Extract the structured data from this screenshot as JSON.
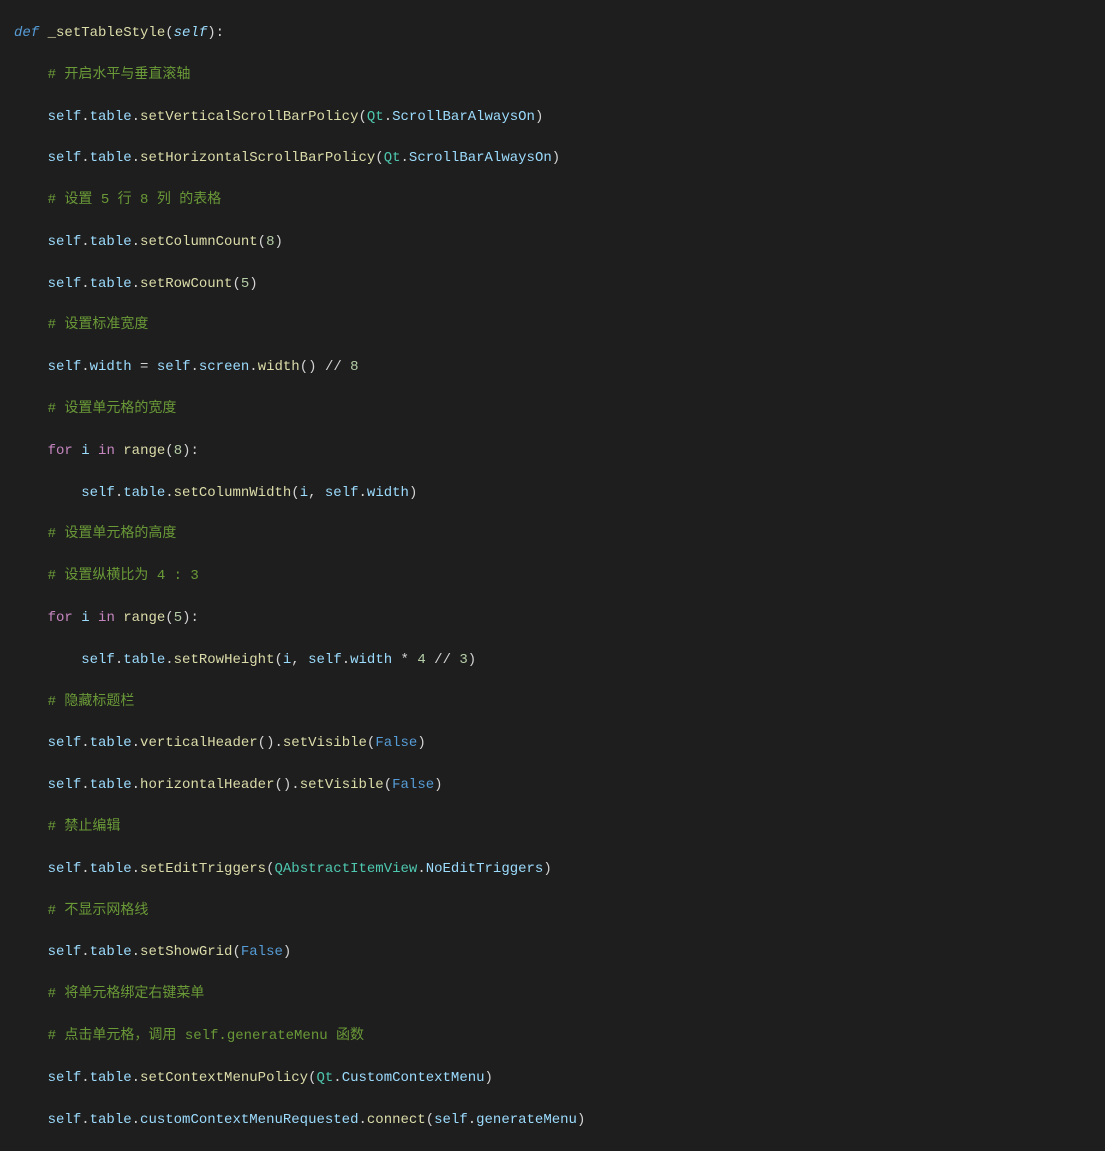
{
  "code": {
    "l1_def": "def",
    "l1_fn": "_setTableStyle",
    "l1_self": "self",
    "l2_cmt": "# 开启水平与垂直滚轴",
    "l3_self": "self",
    "l3_table": "table",
    "l3_method": "setVerticalScrollBarPolicy",
    "l3_cls": "Qt",
    "l3_const": "ScrollBarAlwaysOn",
    "l4_self": "self",
    "l4_table": "table",
    "l4_method": "setHorizontalScrollBarPolicy",
    "l4_cls": "Qt",
    "l4_const": "ScrollBarAlwaysOn",
    "l5_cmt": "# 设置 5 行 8 列 的表格",
    "l6_self": "self",
    "l6_table": "table",
    "l6_method": "setColumnCount",
    "l6_num": "8",
    "l7_self": "self",
    "l7_table": "table",
    "l7_method": "setRowCount",
    "l7_num": "5",
    "l8_cmt": "# 设置标准宽度",
    "l9_self1": "self",
    "l9_width": "width",
    "l9_eq": "=",
    "l9_self2": "self",
    "l9_screen": "screen",
    "l9_method": "width",
    "l9_op": "//",
    "l9_num": "8",
    "l10_cmt": "# 设置单元格的宽度",
    "l11_for": "for",
    "l11_i": "i",
    "l11_in": "in",
    "l11_range": "range",
    "l11_num": "8",
    "l12_self": "self",
    "l12_table": "table",
    "l12_method": "setColumnWidth",
    "l12_i": "i",
    "l12_self2": "self",
    "l12_width": "width",
    "l13_cmt": "# 设置单元格的高度",
    "l14_cmt": "# 设置纵横比为 4 : 3",
    "l15_for": "for",
    "l15_i": "i",
    "l15_in": "in",
    "l15_range": "range",
    "l15_num": "5",
    "l16_self": "self",
    "l16_table": "table",
    "l16_method": "setRowHeight",
    "l16_i": "i",
    "l16_self2": "self",
    "l16_width": "width",
    "l16_mul": "*",
    "l16_n4": "4",
    "l16_div": "//",
    "l16_n3": "3",
    "l17_cmt": "# 隐藏标题栏",
    "l18_self": "self",
    "l18_table": "table",
    "l18_method1": "verticalHeader",
    "l18_method2": "setVisible",
    "l18_false": "False",
    "l19_self": "self",
    "l19_table": "table",
    "l19_method1": "horizontalHeader",
    "l19_method2": "setVisible",
    "l19_false": "False",
    "l20_cmt": "# 禁止编辑",
    "l21_self": "self",
    "l21_table": "table",
    "l21_method": "setEditTriggers",
    "l21_cls": "QAbstractItemView",
    "l21_const": "NoEditTriggers",
    "l22_cmt": "# 不显示网格线",
    "l23_self": "self",
    "l23_table": "table",
    "l23_method": "setShowGrid",
    "l23_false": "False",
    "l24_cmt": "# 将单元格绑定右键菜单",
    "l25_cmt": "# 点击单元格，调用 self.generateMenu 函数",
    "l26_self": "self",
    "l26_table": "table",
    "l26_method": "setContextMenuPolicy",
    "l26_cls": "Qt",
    "l26_const": "CustomContextMenu",
    "l27_self": "self",
    "l27_table": "table",
    "l27_prop": "customContextMenuRequested",
    "l27_method": "connect",
    "l27_self2": "self",
    "l27_gen": "generateMenu"
  }
}
